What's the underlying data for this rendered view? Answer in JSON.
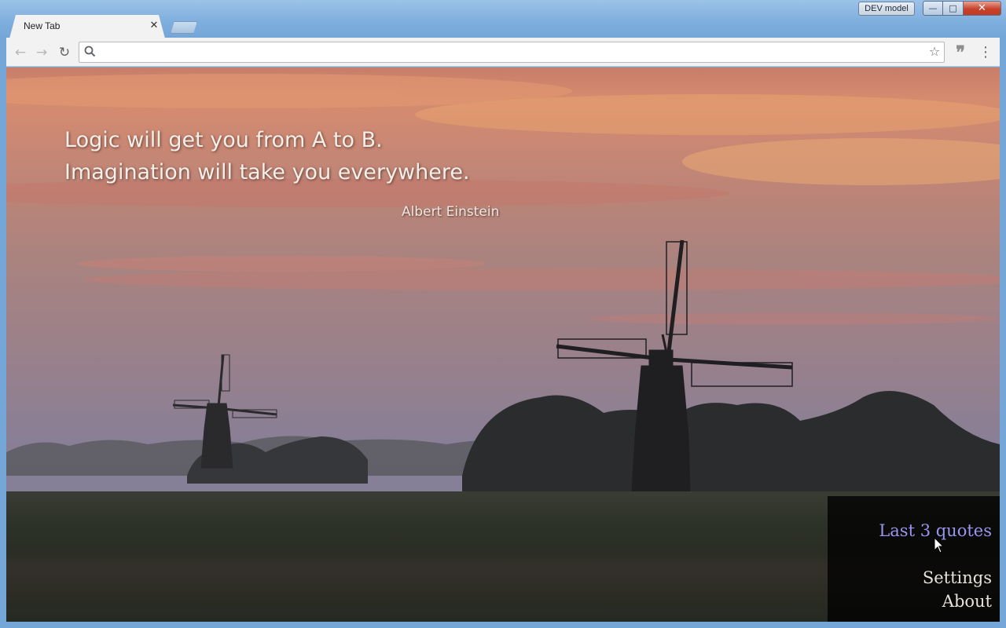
{
  "window": {
    "dev_badge": "DEV model",
    "minimize_glyph": "—",
    "maximize_glyph": "□",
    "close_glyph": "✕"
  },
  "tabs": [
    {
      "title": "New Tab",
      "close_glyph": "✕"
    }
  ],
  "toolbar": {
    "back_glyph": "←",
    "forward_glyph": "→",
    "reload_glyph": "↻",
    "search_icon": "search-icon",
    "omnibox_value": "",
    "star_glyph": "☆",
    "extension_glyph": "❞",
    "menu_glyph": "⋮"
  },
  "page": {
    "quote_lines": [
      "Logic will get you from A to B.",
      "Imagination will take you everywhere."
    ],
    "author": "Albert Einstein",
    "menu": {
      "last_quotes": "Last 3 quotes",
      "settings": "Settings",
      "about": "About"
    },
    "colors": {
      "link_active": "#9a96f0",
      "link": "#e7e2dc",
      "close_button": "#c7432c"
    }
  }
}
